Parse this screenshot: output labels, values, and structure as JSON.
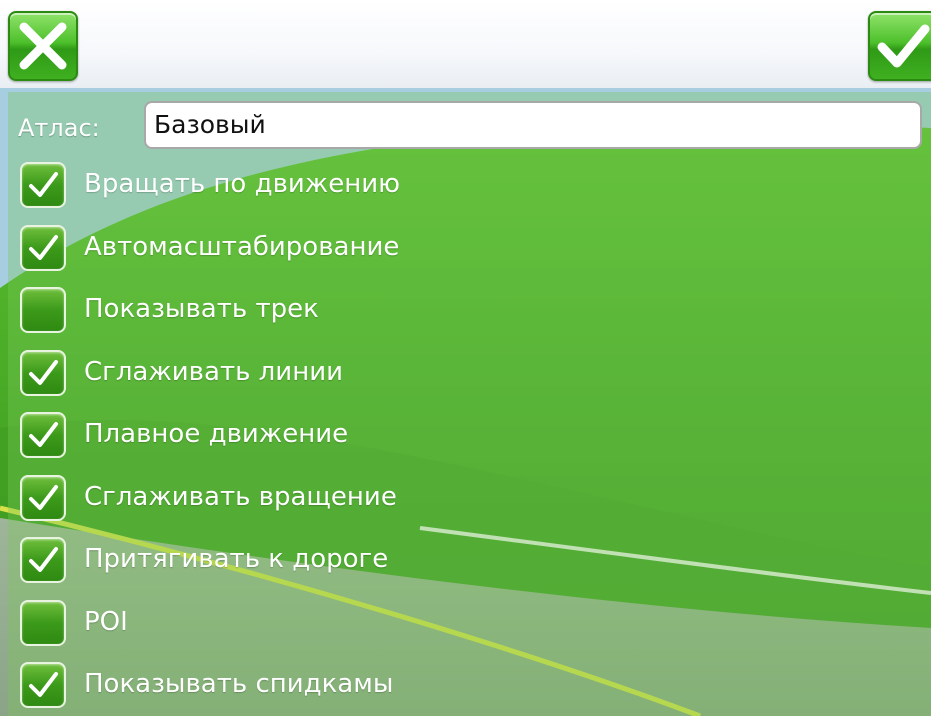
{
  "header": {
    "cancel_icon": "close-x-icon",
    "ok_icon": "checkmark-icon"
  },
  "atlas": {
    "label": "Атлас:",
    "value": "Базовый"
  },
  "options": [
    {
      "label": "Вращать по движению",
      "checked": true
    },
    {
      "label": "Автомасштабирование",
      "checked": true
    },
    {
      "label": "Показывать трек",
      "checked": false
    },
    {
      "label": "Сглаживать линии",
      "checked": true
    },
    {
      "label": "Плавное движение",
      "checked": true
    },
    {
      "label": "Сглаживать вращение",
      "checked": true
    },
    {
      "label": "Притягивать к дороге",
      "checked": true
    },
    {
      "label": "POI",
      "checked": false
    },
    {
      "label": "Показывать спидкамы",
      "checked": true
    }
  ],
  "colors": {
    "accent_green": "#3fb020",
    "label_white": "#ffffff"
  }
}
